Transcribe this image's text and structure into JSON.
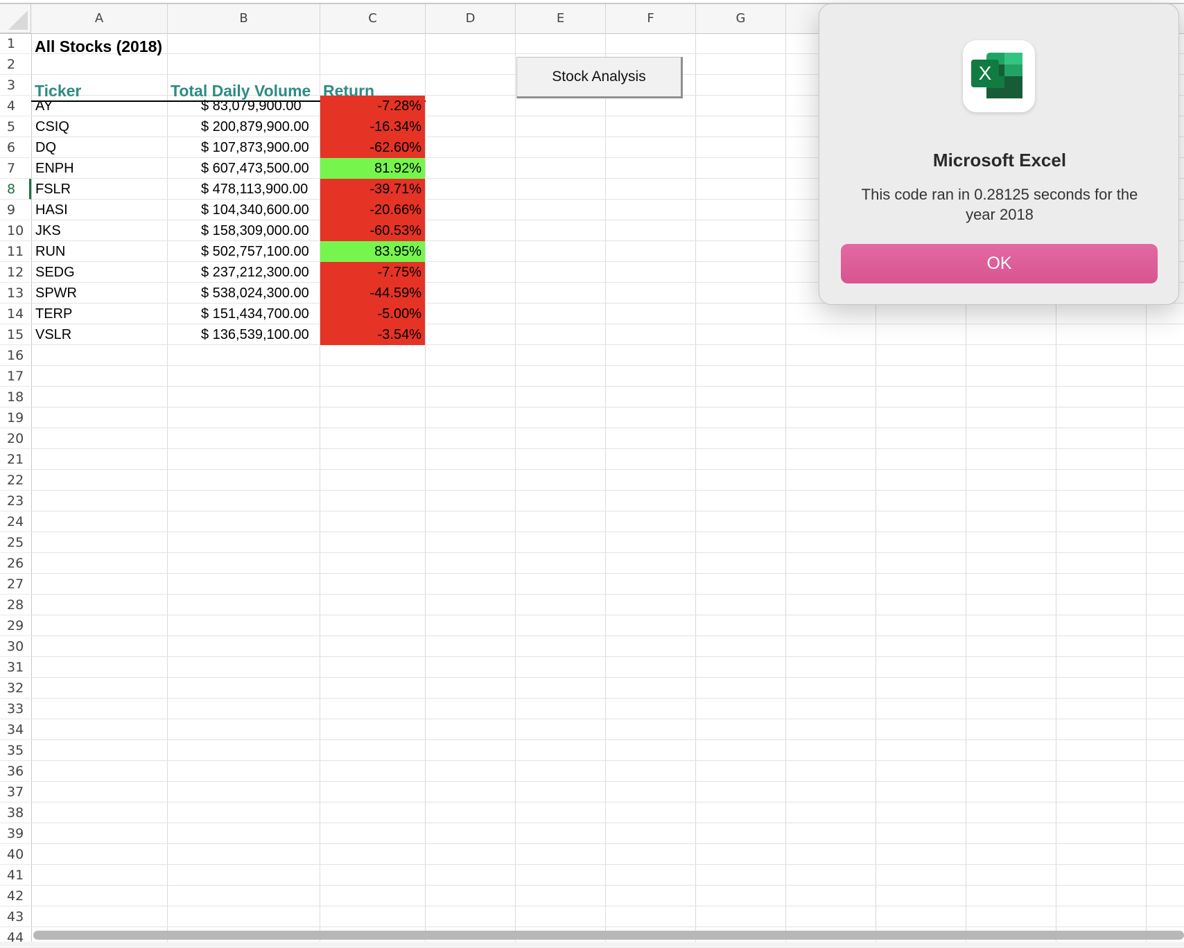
{
  "columns": [
    "A",
    "B",
    "C",
    "D",
    "E",
    "F",
    "G"
  ],
  "row_numbers": [
    "1",
    "2",
    "3",
    "4",
    "5",
    "6",
    "7",
    "8",
    "9",
    "10",
    "11",
    "12",
    "13",
    "14",
    "15",
    "16",
    "17",
    "18",
    "19",
    "20",
    "21",
    "22",
    "23",
    "24",
    "25",
    "26",
    "27",
    "28",
    "29",
    "30",
    "31",
    "32",
    "33",
    "34",
    "35",
    "36",
    "37",
    "38",
    "39",
    "40",
    "41",
    "42",
    "43",
    "44"
  ],
  "selected_row": "8",
  "sheet": {
    "title": "All Stocks (2018)",
    "headers": {
      "ticker": "Ticker",
      "volume": "Total Daily Volume",
      "return": "Return"
    },
    "rows": [
      {
        "ticker": "AY",
        "volume": "$ 83,079,900.00",
        "return": "-7.28%",
        "status": "negative"
      },
      {
        "ticker": "CSIQ",
        "volume": "$ 200,879,900.00",
        "return": "-16.34%",
        "status": "negative"
      },
      {
        "ticker": "DQ",
        "volume": "$ 107,873,900.00",
        "return": "-62.60%",
        "status": "negative"
      },
      {
        "ticker": "ENPH",
        "volume": "$ 607,473,500.00",
        "return": "81.92%",
        "status": "positive"
      },
      {
        "ticker": "FSLR",
        "volume": "$ 478,113,900.00",
        "return": "-39.71%",
        "status": "negative"
      },
      {
        "ticker": "HASI",
        "volume": "$ 104,340,600.00",
        "return": "-20.66%",
        "status": "negative"
      },
      {
        "ticker": "JKS",
        "volume": "$ 158,309,000.00",
        "return": "-60.53%",
        "status": "negative"
      },
      {
        "ticker": "RUN",
        "volume": "$ 502,757,100.00",
        "return": "83.95%",
        "status": "positive"
      },
      {
        "ticker": "SEDG",
        "volume": "$ 237,212,300.00",
        "return": "-7.75%",
        "status": "negative"
      },
      {
        "ticker": "SPWR",
        "volume": "$ 538,024,300.00",
        "return": "-44.59%",
        "status": "negative"
      },
      {
        "ticker": "TERP",
        "volume": "$ 151,434,700.00",
        "return": "-5.00%",
        "status": "negative"
      },
      {
        "ticker": "VSLR",
        "volume": "$ 136,539,100.00",
        "return": "-3.54%",
        "status": "negative"
      }
    ]
  },
  "macro_button": {
    "label": "Stock Analysis"
  },
  "dialog": {
    "title": "Microsoft Excel",
    "message": "This code ran in 0.28125 seconds for the year 2018",
    "ok_label": "OK",
    "icon_letter": "X"
  },
  "colors": {
    "negative_fill": "#e53325",
    "positive_fill": "#76f54d",
    "header_text": "#2e8b84",
    "ok_button": "#d9538f"
  }
}
